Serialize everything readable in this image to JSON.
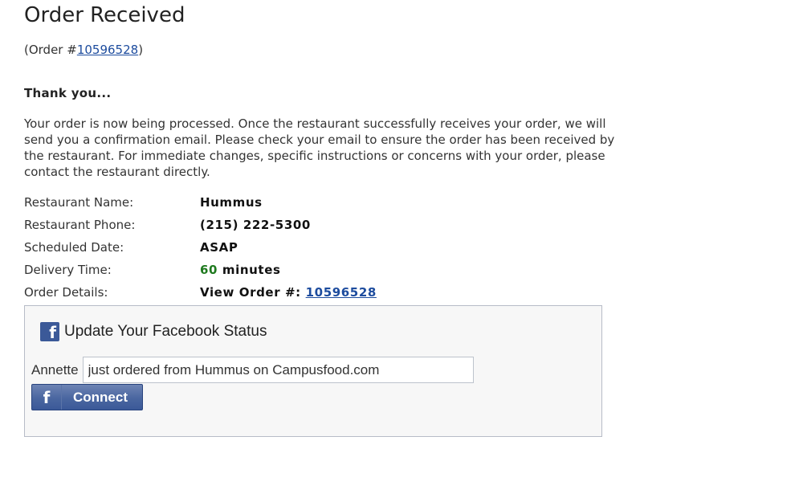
{
  "page": {
    "title": "Order Received",
    "order_ref_prefix": "(Order #",
    "order_number": "10596528",
    "order_ref_suffix": ")",
    "thanks": "Thank you...",
    "message": "Your order is now being processed. Once the restaurant successfully receives your order, we will send you a confirmation email. Please check your email to ensure the order has been received by the restaurant. For immediate changes, specific instructions or concerns with your order, please contact the restaurant directly."
  },
  "details": {
    "restaurant_name_label": "Restaurant Name:",
    "restaurant_name": "Hummus",
    "restaurant_phone_label": "Restaurant Phone:",
    "restaurant_phone": "(215) 222-5300",
    "scheduled_date_label": "Scheduled Date:",
    "scheduled_date": "ASAP",
    "delivery_time_label": "Delivery Time:",
    "delivery_time_value": "60",
    "delivery_time_unit": "minutes",
    "order_details_label": "Order Details:",
    "view_order_prefix": "View Order #:",
    "view_order_number": "10596528"
  },
  "facebook": {
    "icon": "facebook-icon",
    "icon_glyph": "f",
    "title": "Update Your Facebook Status",
    "user_name": "Annette",
    "status_value": "just ordered from Hummus on Campusfood.com",
    "connect_label": "Connect",
    "brand_color": "#3b5998"
  }
}
